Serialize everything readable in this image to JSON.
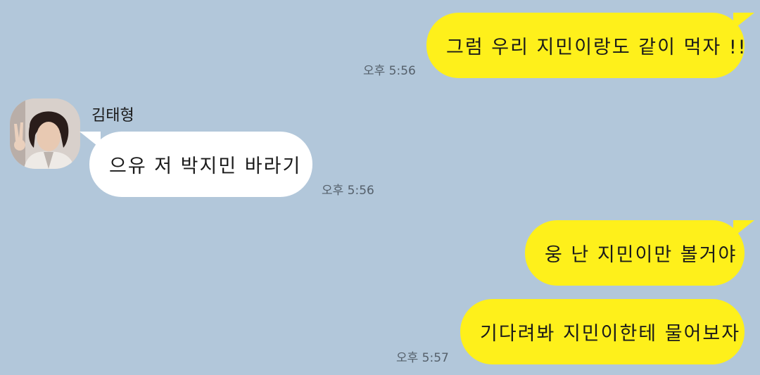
{
  "messages": [
    {
      "direction": "out",
      "text": "그럼 우리 지민이랑도 같이 먹자 !!",
      "time": "오후 5:56"
    },
    {
      "direction": "in",
      "sender": "김태형",
      "text": "으유 저 박지민 바라기",
      "time": "오후 5:56"
    },
    {
      "direction": "out",
      "text": "웅 난 지민이만 볼거야",
      "time": ""
    },
    {
      "direction": "out",
      "text": "기다려봐 지민이한테 물어보자",
      "time": "오후 5:57"
    }
  ],
  "colors": {
    "background": "#b2c7da",
    "outgoing_bubble": "#fef01b",
    "incoming_bubble": "#ffffff",
    "time_text": "#55606b"
  },
  "icons": {
    "avatar": "profile-photo-avatar"
  }
}
